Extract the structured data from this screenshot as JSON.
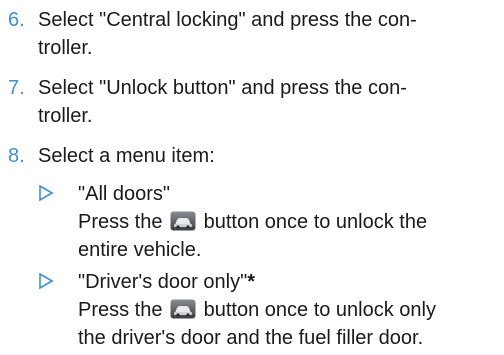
{
  "steps": [
    {
      "num": "6.",
      "line1": "Select \"Central locking\" and press the con-",
      "line2": "troller."
    },
    {
      "num": "7.",
      "line1": "Select \"Unlock button\" and press the con-",
      "line2": "troller."
    },
    {
      "num": "8.",
      "line1": "Select a menu item:"
    }
  ],
  "options": [
    {
      "title": "\"All doors\"",
      "before_icon": "Press the",
      "after_icon": "button once to unlock the",
      "line3": "entire vehicle."
    },
    {
      "title": "\"Driver's door only\"",
      "title_mark": "*",
      "before_icon": "Press the",
      "after_icon": "button once to unlock only",
      "line3": "the driver's door and the fuel filler door."
    }
  ],
  "icons": {
    "bullet": "triangle-outline-icon",
    "button": "car-unlock-button-icon"
  },
  "colors": {
    "accent": "#3f8fd2",
    "text": "#1a1a1a"
  }
}
